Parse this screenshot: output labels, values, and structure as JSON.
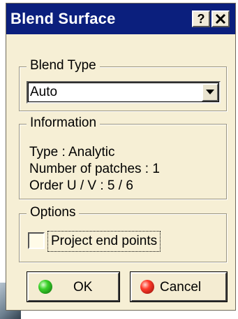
{
  "window": {
    "title": "Blend Surface",
    "help_button": "?",
    "close_button": "✕"
  },
  "blend_type": {
    "legend": "Blend Type",
    "selected": "Auto"
  },
  "information": {
    "legend": "Information",
    "type_line": "Type : Analytic",
    "patches_line": "Number of patches : 1",
    "order_line": "Order U / V : 5 / 6"
  },
  "options": {
    "legend": "Options",
    "project_end_points": {
      "label": "Project end points",
      "checked": false
    }
  },
  "buttons": {
    "ok": "OK",
    "cancel": "Cancel"
  },
  "colors": {
    "titlebar": "#0b1f7d",
    "dialog_bg": "#f6efd5",
    "ok_indicator": "#3bd12a",
    "cancel_indicator": "#ff3a2a"
  }
}
